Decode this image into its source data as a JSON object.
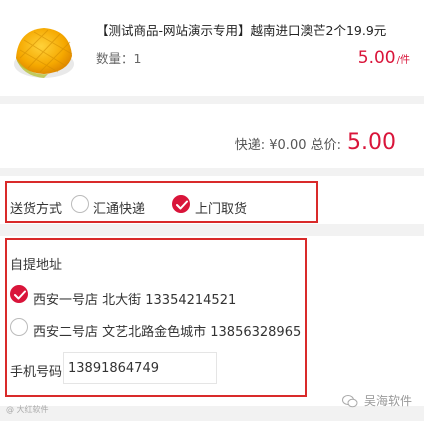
{
  "product": {
    "title": "【测试商品-网站演示专用】越南进口澳芒2个19.9元",
    "quantity_label": "数量：",
    "quantity": "1",
    "price": "5.00",
    "price_unit": "/件",
    "image_icon": "mango-image"
  },
  "summary": {
    "shipping_label": "快递:",
    "shipping_value": "¥0.00",
    "total_label": "总价:",
    "total_value": "5.00"
  },
  "delivery": {
    "label": "送货方式",
    "options": [
      {
        "label": "汇通快递",
        "checked": false
      },
      {
        "label": "上门取货",
        "checked": true
      }
    ]
  },
  "pickup": {
    "title": "自提地址",
    "stores": [
      {
        "text": "西安一号店 北大街 13354214521",
        "checked": true
      },
      {
        "text": "西安二号店 文艺北路金色城市 13856328965",
        "checked": false
      }
    ],
    "phone_label": "手机号码",
    "phone_value": "13891864749"
  },
  "watermark": {
    "left": "@ 大红软件",
    "right": "吴海软件",
    "right_icon": "wechat-icon"
  },
  "colors": {
    "accent": "#d9153a",
    "highlight_frame": "#d92a2a",
    "background": "#f2f2f2"
  }
}
